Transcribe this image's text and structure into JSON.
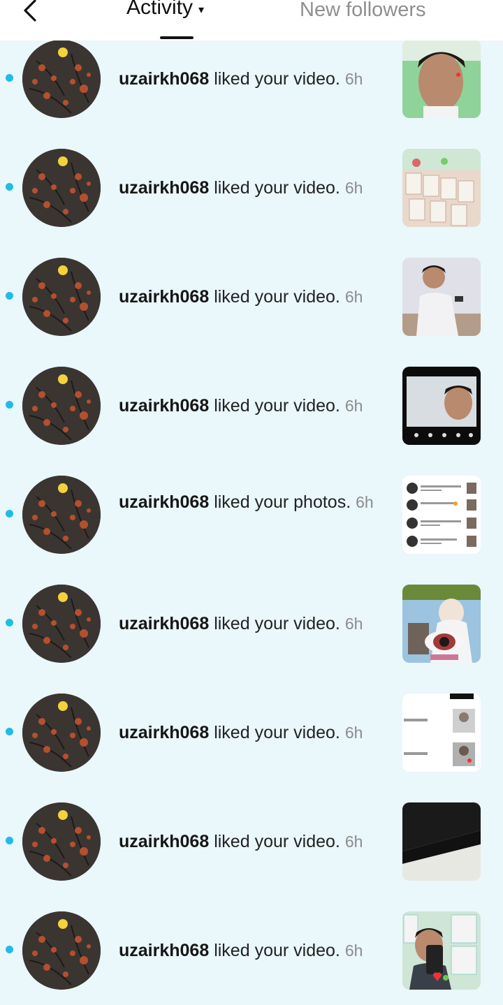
{
  "header": {
    "back_icon": "chevron-left-icon",
    "tab_activity": "Activity",
    "tab_activity_caret": "▾",
    "tab_followers": "New followers"
  },
  "colors": {
    "unread_dot": "#1fbde6",
    "background": "#eaf7fb"
  },
  "notifications": [
    {
      "user": "uzairkh068",
      "action": "liked your video.",
      "time": "6h",
      "thumbnail": "selfie-portrait"
    },
    {
      "user": "uzairkh068",
      "action": "liked your video.",
      "time": "6h",
      "thumbnail": "shop-shelves"
    },
    {
      "user": "uzairkh068",
      "action": "liked your video.",
      "time": "6h",
      "thumbnail": "man-sitting-phone"
    },
    {
      "user": "uzairkh068",
      "action": "liked your video.",
      "time": "6h",
      "thumbnail": "screen-recording-selfie"
    },
    {
      "user": "uzairkh068",
      "action": "liked your photos.",
      "time": "6h",
      "thumbnail": "notifications-screenshot"
    },
    {
      "user": "uzairkh068",
      "action": "liked your video.",
      "time": "6h",
      "thumbnail": "eye-collage"
    },
    {
      "user": "uzairkh068",
      "action": "liked your video.",
      "time": "6h",
      "thumbnail": "list-screenshot"
    },
    {
      "user": "uzairkh068",
      "action": "liked your video.",
      "time": "6h",
      "thumbnail": "black-white-diagonal"
    },
    {
      "user": "uzairkh068",
      "action": "liked your video.",
      "time": "6h",
      "thumbnail": "mirror-selfie"
    }
  ]
}
